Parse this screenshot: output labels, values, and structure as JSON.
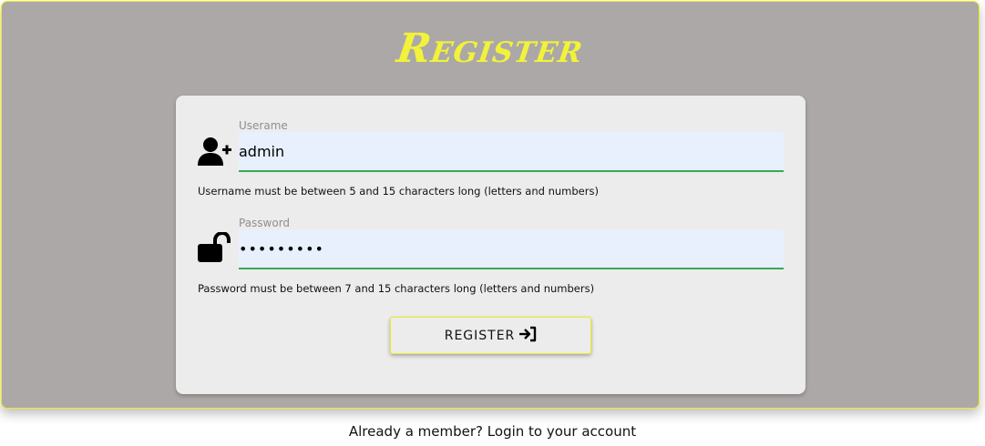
{
  "header": {
    "title": "Register"
  },
  "form": {
    "username": {
      "label": "Userame",
      "value": "admin",
      "icon": "user-plus-icon",
      "help": "Username must be between 5 and 15 characters long (letters and numbers)"
    },
    "password": {
      "label": "Password",
      "value": "•••••••••",
      "icon": "unlock-icon",
      "help": "Password must be between 7 and 15 characters long (letters and numbers)"
    },
    "submit": {
      "label": "REGISTER",
      "icon": "sign-in-icon"
    }
  },
  "footer": {
    "prompt": "Already a member?",
    "link": "Login to your account"
  },
  "colors": {
    "accent_yellow": "#f2f23a",
    "panel_gray": "#aca8a7",
    "input_fill": "#e8f0fe",
    "input_underline": "#3aa757"
  }
}
